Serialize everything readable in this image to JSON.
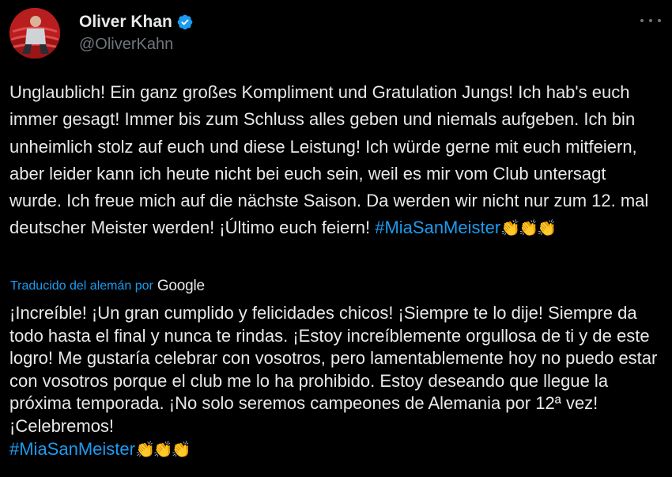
{
  "author": {
    "display_name": "Oliver Khan",
    "handle": "@OliverKahn",
    "verified_color": "#1d9bf0"
  },
  "tweet": {
    "text": "Unglaublich! Ein ganz großes Kompliment und Gratulation Jungs! Ich hab's euch immer gesagt! Immer bis zum Schluss alles geben und niemals aufgeben. Ich bin unheimlich stolz auf euch und diese Leistung! Ich würde gerne mit euch mitfeiern, aber leider kann ich heute nicht bei euch sein, weil es mir vom Club untersagt wurde. Ich freue mich auf die nächste Saison. Da werden wir nicht nur zum 12. mal deutscher Meister werden! ¡Último euch feiern!",
    "hashtag": "#MiaSanMeister",
    "emoji": "👏👏👏"
  },
  "translation_bar": {
    "label": "Traducido del alemán por",
    "provider": "Google"
  },
  "translation": {
    "text": "¡Increíble! ¡Un gran cumplido y felicidades chicos! ¡Siempre te lo dije! Siempre da todo hasta el final y nunca te rindas. ¡Estoy increíblemente orgullosa de ti y de este logro! Me gustaría celebrar con vosotros, pero lamentablemente hoy no puedo estar con vosotros porque el club me lo ha prohibido. Estoy deseando que llegue la próxima temporada. ¡No solo seremos campeones de Alemania por 12ª vez! ¡Celebremos!",
    "hashtag": "#MiaSanMeister",
    "emoji": "👏👏👏"
  },
  "icons": {
    "more": "more-options-icon",
    "verified": "verified-badge-icon"
  },
  "colors": {
    "background": "#000000",
    "text": "#e7e9ea",
    "secondary": "#71767b",
    "link": "#1d9bf0"
  }
}
